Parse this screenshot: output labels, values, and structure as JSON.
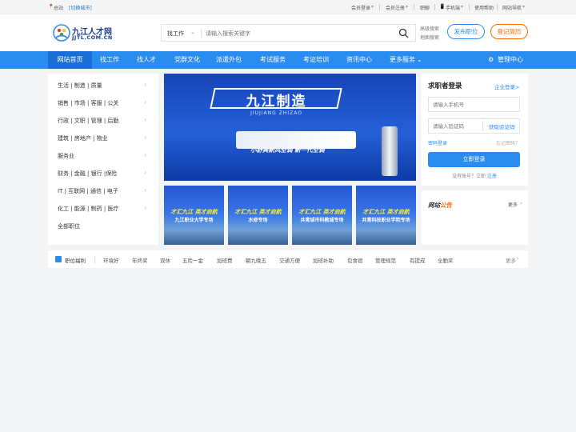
{
  "topbar": {
    "site": "总站",
    "switch_city": "[切换城市]",
    "member_login": "会员登录",
    "member_register": "会员注册",
    "jobs": "职聊",
    "mobile": "手机端",
    "help": "使用帮助",
    "site_nav": "网站导航"
  },
  "header": {
    "logo_cn": "九江人才网",
    "logo_en": "JJTL.COM.CN",
    "search_type": "找工作",
    "search_placeholder": "请输入搜索关键字",
    "advanced_search": "高级搜索",
    "map_search": "地图搜索",
    "post_job": "发布职位",
    "register_resume": "登记简历"
  },
  "nav": {
    "items": [
      "网站首页",
      "找工作",
      "找人才",
      "党群文化",
      "派遣外包",
      "考试服务",
      "考证培训",
      "资讯中心",
      "更多服务"
    ],
    "admin": "管理中心"
  },
  "categories": [
    "生活 | 制造 | 质量",
    "销售 | 市场 | 客服 | 公关",
    "行政 | 文职 | 管理 | 后勤",
    "建筑 | 房地产 | 物业",
    "服务业",
    "财务 | 金融 | 银行 |保险",
    "IT | 互联网 | 通信 | 电子",
    "化工 | 能源 | 制药 | 医疗",
    "全部职位"
  ],
  "banner": {
    "title": "九江制造",
    "pinyin": "JIUJIANG ZHIZAO",
    "slogan": "小舒爽新风空调 新一代空调"
  },
  "thumbs": [
    {
      "line1": "才汇九江 英才启航",
      "line2": "九江职业大学专场"
    },
    {
      "line1": "才汇九江 英才启航",
      "line2": "水修专场"
    },
    {
      "line1": "才汇九江 英才启航",
      "line2": "共青城市科教城专场"
    },
    {
      "line1": "才汇九江 英才启航",
      "line2": "共青科技职业学院专场"
    }
  ],
  "login": {
    "title": "求职者登录",
    "company_login": "企业登录>",
    "phone_placeholder": "请输入手机号",
    "code_placeholder": "请输入验证码",
    "get_code": "获取验证码",
    "password_login": "密码登录",
    "forgot_password": "忘记密码？",
    "login_button": "立即登录",
    "no_account": "没有账号？立即",
    "register": "注册"
  },
  "news": {
    "title_a": "网站",
    "title_b": "公告",
    "more": "更多"
  },
  "welfare": {
    "label": "职位福利",
    "items": [
      "环境好",
      "年终奖",
      "双休",
      "五险一金",
      "加班费",
      "朝九晚五",
      "交通方便",
      "加班补助",
      "包食宿",
      "管理规范",
      "有提成",
      "全勤奖"
    ],
    "more": "更多"
  },
  "colors": {
    "primary": "#2b8cf0",
    "nav_active": "#1a6fd6",
    "accent_orange": "#ff6a00"
  }
}
